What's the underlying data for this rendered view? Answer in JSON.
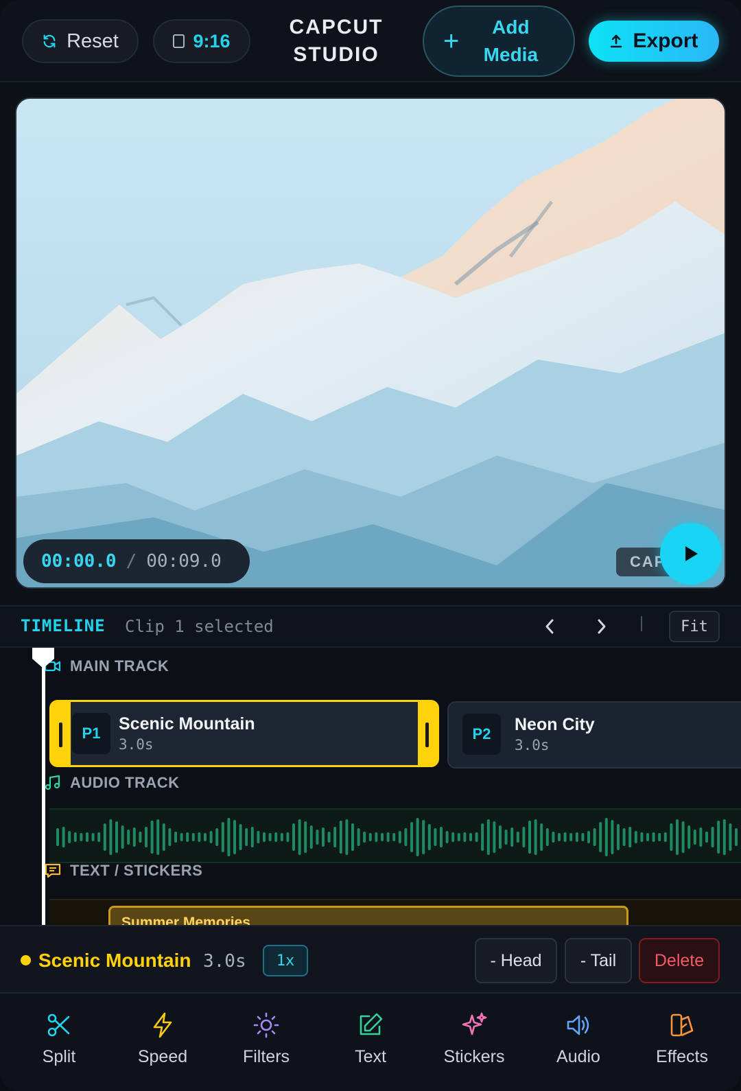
{
  "header": {
    "reset_label": "Reset",
    "ratio_label": "9:16",
    "brand_line1": "CAPCUT",
    "brand_line2": "STUDIO",
    "add_media_line1": "Add",
    "add_media_line2": "Media",
    "export_label": "Export",
    "accent": "#22d3ee"
  },
  "preview": {
    "current_time": "00:00.0",
    "separator": "/",
    "total_time": "00:09.0",
    "watermark": "CAP"
  },
  "timeline": {
    "title": "TIMELINE",
    "status": "Clip 1 selected",
    "fit_label": "Fit",
    "divider": "|",
    "tracks": {
      "main": {
        "label": "MAIN TRACK",
        "icon": "video-camera-icon"
      },
      "audio": {
        "label": "AUDIO TRACK",
        "icon": "music-note-icon"
      },
      "text": {
        "label": "TEXT / STICKERS",
        "icon": "message-icon"
      }
    },
    "clips": [
      {
        "tag": "P1",
        "name": "Scenic Mountain",
        "duration": "3.0s",
        "selected": true
      },
      {
        "tag": "P2",
        "name": "Neon City",
        "duration": "3.0s",
        "selected": false
      }
    ],
    "sticker": {
      "text": "Summer Memories"
    }
  },
  "selection": {
    "name": "Scenic Mountain",
    "duration": "3.0s",
    "speed": "1x",
    "head_label": "- Head",
    "tail_label": "- Tail",
    "delete_label": "Delete",
    "color": "#ffd20a"
  },
  "tools": [
    {
      "label": "Split",
      "icon": "scissors-icon",
      "color": "#22d3ee"
    },
    {
      "label": "Speed",
      "icon": "lightning-icon",
      "color": "#facc15"
    },
    {
      "label": "Filters",
      "icon": "sun-icon",
      "color": "#a78bfa"
    },
    {
      "label": "Text",
      "icon": "edit-icon",
      "color": "#34d399"
    },
    {
      "label": "Stickers",
      "icon": "sparkles-icon",
      "color": "#f472b6"
    },
    {
      "label": "Audio",
      "icon": "speaker-icon",
      "color": "#60a5fa"
    },
    {
      "label": "Effects",
      "icon": "effects-icon",
      "color": "#fb923c"
    }
  ]
}
